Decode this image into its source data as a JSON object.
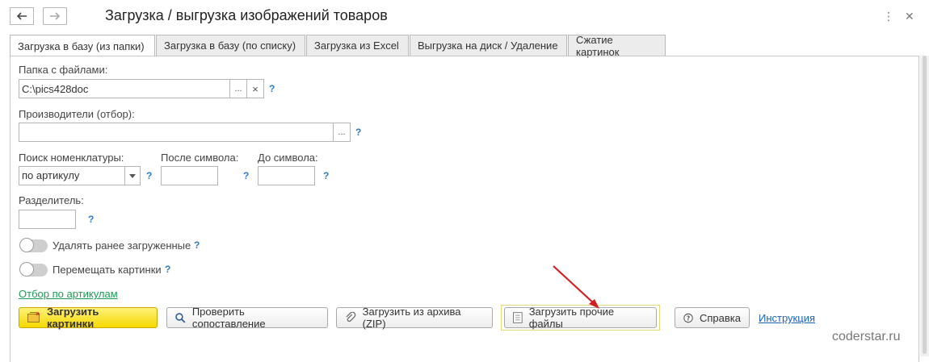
{
  "header": {
    "title": "Загрузка / выгрузка изображений товаров"
  },
  "tabs": [
    {
      "label": "Загрузка в базу (из папки)",
      "active": true
    },
    {
      "label": "Загрузка в базу (по списку)",
      "active": false
    },
    {
      "label": "Загрузка из Excel",
      "active": false
    },
    {
      "label": "Выгрузка на диск / Удаление",
      "active": false
    },
    {
      "label": "Сжатие картинок",
      "active": false
    }
  ],
  "form": {
    "folder_label": "Папка с файлами:",
    "folder_value": "C:\\pics428doc",
    "manufacturers_label": "Производители (отбор):",
    "manufacturers_value": "",
    "search_label": "Поиск номенклатуры:",
    "search_value": "по артикулу",
    "after_label": "После символа:",
    "after_value": "",
    "before_label": "До символа:",
    "before_value": "",
    "separator_label": "Разделитель:",
    "separator_value": "",
    "delete_toggle_label": "Удалять ранее загруженные",
    "move_toggle_label": "Перемещать картинки",
    "filter_link": "Отбор по артикулам",
    "help_mark": "?",
    "ellipsis": "...",
    "clear": "×"
  },
  "buttons": {
    "load_images": "Загрузить картинки",
    "check_mapping": "Проверить сопоставление",
    "load_zip": "Загрузить из архива (ZIP)",
    "load_other": "Загрузить прочие файлы",
    "help": "Справка",
    "instruction": "Инструкция"
  },
  "watermark": "coderstar.ru",
  "colors": {
    "primary_button": "#f5d800",
    "help_mark": "#2a7bc2",
    "filter_link": "#1a9c52",
    "arrow": "#d22020",
    "highlight_border": "#e8d870"
  }
}
